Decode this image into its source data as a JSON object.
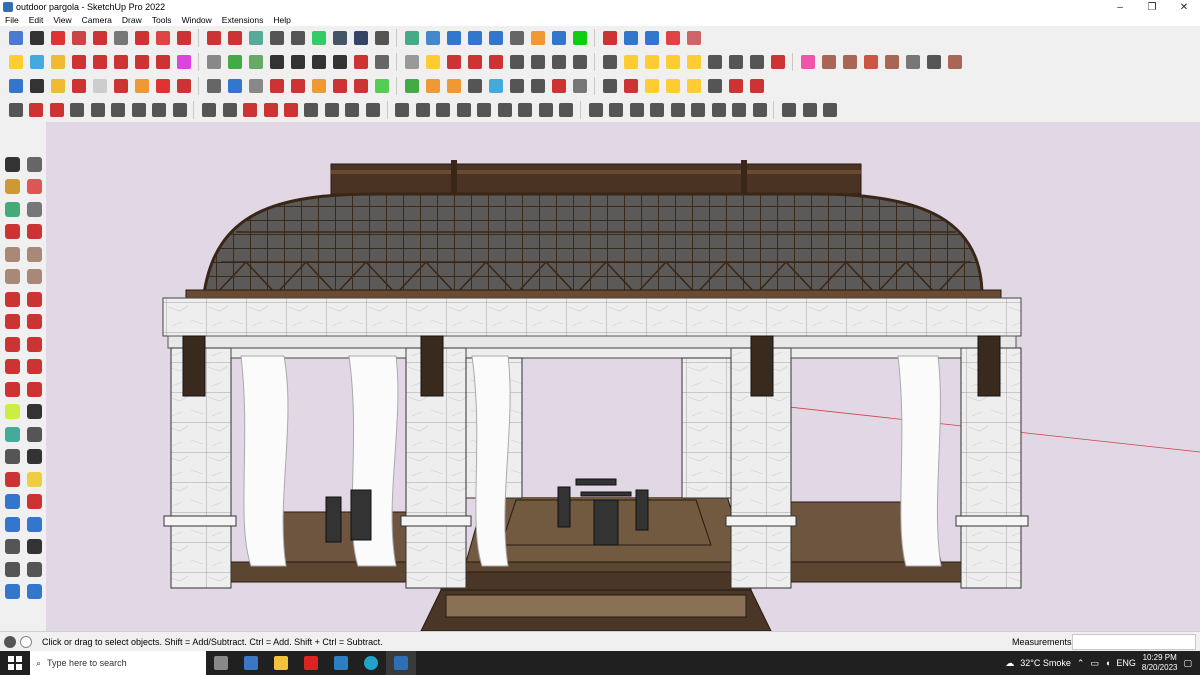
{
  "window": {
    "title": "outdoor pargola - SketchUp Pro 2022",
    "minimize": "–",
    "maximize": "❐",
    "close": "✕"
  },
  "menu": [
    "File",
    "Edit",
    "View",
    "Camera",
    "Draw",
    "Tools",
    "Window",
    "Extensions",
    "Help"
  ],
  "toolbars": {
    "row1": [
      "#4a7bd1",
      "#333",
      "#d33",
      "#c44",
      "#c33",
      "#777",
      "#c33",
      "#d44",
      "#c33",
      "#c33",
      "#c33",
      "#5a9",
      "#555",
      "#555",
      "#3c6",
      "#456",
      "#346",
      "#555",
      "#4a8",
      "#48c",
      "#37c",
      "#37c",
      "#37c",
      "#666",
      "#e93",
      "#37c",
      "#1c1",
      "#c33",
      "#37c",
      "#37c",
      "#d44",
      "#c66"
    ],
    "row2": [
      "#fc3",
      "#4ad",
      "#eb3",
      "#c33",
      "#c33",
      "#c33",
      "#c33",
      "#c33",
      "#d4d",
      "#888",
      "#4a4",
      "#6a6",
      "#333",
      "#333",
      "#333",
      "#333",
      "#c33",
      "#666",
      "#999",
      "#fc3",
      "#c33",
      "#c33",
      "#c33",
      "#555",
      "#555",
      "#555",
      "#555",
      "#555",
      "#fc3",
      "#fc3",
      "#fc3",
      "#fc3",
      "#555",
      "#555",
      "#555",
      "#c33",
      "#e5a",
      "#a65",
      "#a65",
      "#c54",
      "#a65",
      "#777",
      "#555",
      "#a65"
    ],
    "row3": [
      "#37c",
      "#333",
      "#eb3",
      "#c33",
      "#ccc",
      "#c33",
      "#e93",
      "#d33",
      "#c33",
      "#666",
      "#37c",
      "#888",
      "#c33",
      "#c33",
      "#e93",
      "#c33",
      "#c33",
      "#5c5",
      "#4a4",
      "#e93",
      "#e93",
      "#555",
      "#4ad",
      "#555",
      "#555",
      "#c33",
      "#777",
      "#555",
      "#c33",
      "#fc3",
      "#fc3",
      "#fc3",
      "#555",
      "#c33",
      "#c33"
    ],
    "row4": [
      "#555",
      "#c33",
      "#c33",
      "#555",
      "#555",
      "#555",
      "#555",
      "#555",
      "#555",
      "#555",
      "#555",
      "#c33",
      "#c33",
      "#c33",
      "#555",
      "#555",
      "#555",
      "#555",
      "#555",
      "#555",
      "#555",
      "#555",
      "#555",
      "#555",
      "#555",
      "#555",
      "#555",
      "#555",
      "#555",
      "#555",
      "#555",
      "#555",
      "#555",
      "#555",
      "#555",
      "#555",
      "#555",
      "#555",
      "#555"
    ]
  },
  "left_tools": [
    "#333",
    "#666",
    "#c93",
    "#d55",
    "#4a7",
    "#777",
    "#c33",
    "#c33",
    "#a87",
    "#a87",
    "#a87",
    "#a87",
    "#c33",
    "#c33",
    "#c33",
    "#c33",
    "#c33",
    "#c33",
    "#c33",
    "#c33",
    "#c33",
    "#c33",
    "#ce4",
    "#333",
    "#4a9",
    "#555",
    "#555",
    "#333",
    "#c33",
    "#ec4",
    "#37c",
    "#c33",
    "#37c",
    "#37c",
    "#555",
    "#333",
    "#555",
    "#555",
    "#37c",
    "#37c"
  ],
  "status": {
    "hint": "Click or drag to select objects. Shift = Add/Subtract. Ctrl = Add. Shift + Ctrl = Subtract.",
    "measurements_label": "Measurements",
    "measurements_value": ""
  },
  "taskbar": {
    "search_placeholder": "Type here to search",
    "weather": "32°C  Smoke",
    "language": "ENG",
    "time": "10:29 PM",
    "date": "8/20/2023"
  }
}
